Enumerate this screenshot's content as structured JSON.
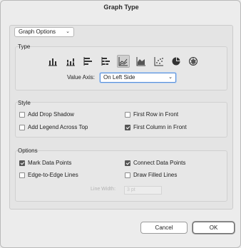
{
  "title": "Graph Type",
  "options_dropdown": "Graph Options",
  "type_group": {
    "label": "Type",
    "icons": [
      "column-graph-icon",
      "stacked-column-graph-icon",
      "bar-graph-icon",
      "stacked-bar-graph-icon",
      "line-graph-icon",
      "area-graph-icon",
      "scatter-graph-icon",
      "pie-graph-icon",
      "radar-graph-icon"
    ],
    "selected": "line-graph-icon",
    "value_axis_label": "Value Axis:",
    "value_axis_value": "On Left Side"
  },
  "style_group": {
    "label": "Style",
    "items": [
      {
        "label": "Add Drop Shadow",
        "checked": false
      },
      {
        "label": "First Row in Front",
        "checked": false
      },
      {
        "label": "Add Legend Across Top",
        "checked": false
      },
      {
        "label": "First Column in Front",
        "checked": true
      }
    ]
  },
  "options_group": {
    "label": "Options",
    "items": [
      {
        "label": "Mark Data Points",
        "checked": true
      },
      {
        "label": "Connect Data Points",
        "checked": true
      },
      {
        "label": "Edge-to-Edge Lines",
        "checked": false
      },
      {
        "label": "Draw Filled Lines",
        "checked": false
      }
    ],
    "line_width_label": "Line Width:",
    "line_width_value": "3 pt"
  },
  "buttons": {
    "cancel": "Cancel",
    "ok": "OK"
  }
}
